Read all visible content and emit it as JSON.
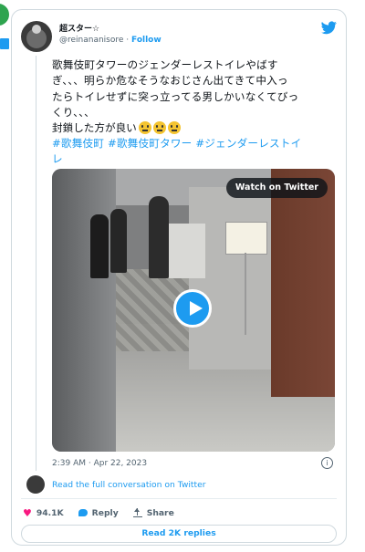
{
  "tweet": {
    "name": "超スター☆",
    "handle": "@reinananisore",
    "follow_label": "Follow",
    "text": "歌舞伎町タワーのジェンダーレストイレやばす\nぎ、、、明らか危なそうなおじさん出てきて中入っ\nたらトイレせずに突っ立ってる男しかいなくてびっ\nくり、、、",
    "text_last": "封鎖した方が良い",
    "emoji_count": 3,
    "hashtags": "#歌舞伎町 #歌舞伎町タワー #ジェンダーレストイ\nレ",
    "video": {
      "watch_label": "Watch on Twitter"
    },
    "timestamp": "2:39 AM · Apr 22, 2023"
  },
  "footer": {
    "conversation_link": "Read the full conversation on Twitter",
    "likes_count": "94.1K",
    "reply_label": "Reply",
    "share_label": "Share",
    "read_replies_label": "Read 2K replies"
  },
  "icons": {
    "bird": "twitter-bird-icon",
    "heart": "heart-icon",
    "reply": "reply-icon",
    "share": "share-icon",
    "info": "info-icon"
  },
  "colors": {
    "accent": "#1d9bf0",
    "like": "#f91880",
    "text": "#0f1419",
    "muted": "#536471",
    "border": "#cfd9de"
  }
}
